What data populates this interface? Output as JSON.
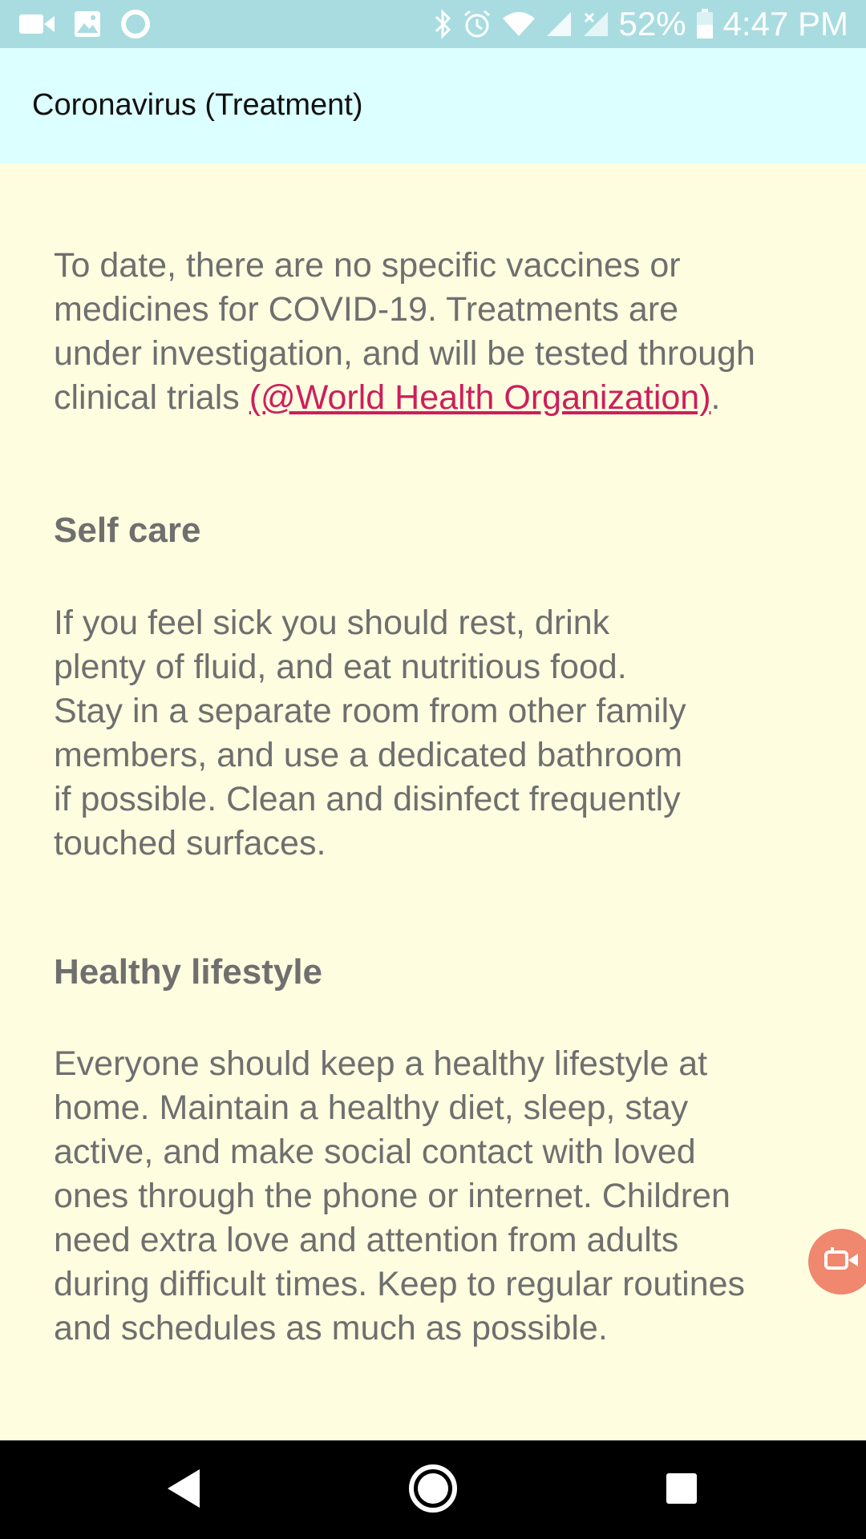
{
  "status_bar": {
    "battery": "52%",
    "time": "4:47 PM",
    "icons_left": [
      "video-icon",
      "image-icon",
      "circle-icon"
    ],
    "icons_right": [
      "bluetooth-icon",
      "alarm-icon",
      "wifi-icon",
      "signal-icon",
      "signal-x-icon",
      "battery-icon"
    ]
  },
  "app_bar": {
    "title": "Coronavirus (Treatment)"
  },
  "content": {
    "intro_text": "To date, there are no specific vaccines or\nmedicines for COVID-19. Treatments are\nunder investigation, and will be tested through\nclinical trials ",
    "intro_link": "(@World Health Organization)",
    "intro_end": ".",
    "sections": [
      {
        "heading": "Self care",
        "body": "If you feel sick you should rest, drink\nplenty of fluid, and eat nutritious food.\nStay in a separate room from other family\nmembers, and use a dedicated bathroom\nif possible. Clean and disinfect frequently\ntouched surfaces."
      },
      {
        "heading": "Healthy lifestyle",
        "body": "Everyone should keep a healthy lifestyle at\nhome. Maintain a healthy diet, sleep, stay\nactive, and make social contact with loved\nones through the phone or internet. Children\nneed extra love and attention from adults\nduring difficult times. Keep to regular routines\nand schedules as much as possible."
      }
    ]
  },
  "fab": {
    "icon": "screen-record-icon"
  },
  "nav_bar": {
    "buttons": [
      "back-icon",
      "home-icon",
      "recents-icon"
    ]
  },
  "colors": {
    "status_bar": "#a8dce0",
    "app_bar": "#dcffff",
    "background": "#fffde0",
    "link": "#cc1f5c",
    "text": "#6f6f6f",
    "fab": "#f0876f"
  }
}
